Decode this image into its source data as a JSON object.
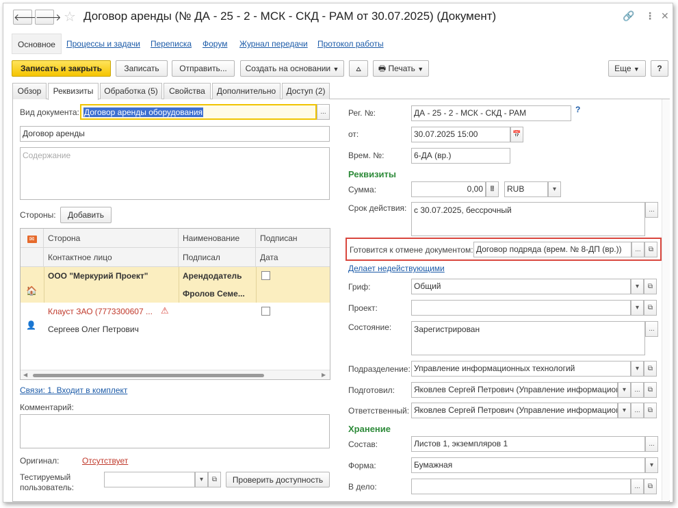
{
  "window": {
    "title": "Договор аренды (№ ДА - 25 - 2 - МСК - СКД - РАМ от 30.07.2025) (Документ)",
    "icons": {
      "back": "arrow-left-icon",
      "forward": "arrow-right-icon",
      "favorite": "star-icon",
      "link": "link-icon",
      "more": "more-vertical-icon",
      "close": "close-icon"
    }
  },
  "sections": [
    "Основное",
    "Процессы и задачи",
    "Переписка",
    "Форум",
    "Журнал передачи",
    "Протокол работы"
  ],
  "toolbar": {
    "save_close": "Записать и закрыть",
    "save": "Записать",
    "send": "Отправить...",
    "create_based": "Создать на основании",
    "share_icon": "share-icon",
    "print": "Печать",
    "more": "Еще",
    "help": "?"
  },
  "tabs": [
    "Обзор",
    "Реквизиты",
    "Обработка (5)",
    "Свойства",
    "Дополнительно",
    "Доступ (2)"
  ],
  "left": {
    "doc_type_label": "Вид документа:",
    "doc_type_value": "Договор аренды оборудования",
    "title_value": "Договор аренды",
    "content_placeholder": "Содержание",
    "parties_label": "Стороны:",
    "add_button": "Добавить",
    "grid": {
      "headers_row1": [
        "Сторона",
        "Наименование",
        "Подписан"
      ],
      "headers_row2": [
        "Контактное лицо",
        "Подписал",
        "Дата"
      ],
      "rows": [
        {
          "party": "ООО \"Меркурий Проект\"",
          "role": "Арендодатель",
          "signed": false
        },
        {
          "contact": "",
          "signer": "Фролов Семе..."
        },
        {
          "party": "Клауст ЗАО (7773300607 ...",
          "role": "",
          "signed": false,
          "warning": true
        },
        {
          "contact": "Сергеев Олег Петрович"
        }
      ]
    },
    "links_text": "Связи: 1. Входит в комплект",
    "comment_label": "Комментарий:",
    "original_label": "Оригинал:",
    "original_value": "Отсутствует",
    "test_user_label_1": "Тестируемый",
    "test_user_label_2": "пользователь:",
    "check_access_button": "Проверить доступность"
  },
  "right": {
    "reg_no_label": "Рег. №:",
    "reg_no_value": "ДА - 25 - 2 - МСК - СКД - РАМ",
    "help_mark": "?",
    "date_label": "от:",
    "date_value": "30.07.2025 15:00",
    "temp_no_label": "Врем. №:",
    "temp_no_value": "6-ДА (вр.)",
    "requisites_section": "Реквизиты",
    "sum_label": "Сумма:",
    "sum_value": "0,00",
    "currency_value": "RUB",
    "validity_label": "Срок действия:",
    "validity_value": "с 30.07.2025, бессрочный",
    "cancel_label": "Готовится к отмене документом:",
    "cancel_value": "Договор подряда (врем. № 8-ДП (вр.))",
    "invalidates_link": "Делает недействующими",
    "grif_label": "Гриф:",
    "grif_value": "Общий",
    "project_label": "Проект:",
    "project_value": "",
    "state_label": "Состояние:",
    "state_value": "Зарегистрирован",
    "department_label": "Подразделение:",
    "department_value": "Управление информационных технологий",
    "prepared_label": "Подготовил:",
    "prepared_value": "Яковлев Сергей Петрович (Управление информационны",
    "responsible_label": "Ответственный:",
    "responsible_value": "Яковлев Сергей Петрович (Управление информационны",
    "storage_section": "Хранение",
    "composition_label": "Состав:",
    "composition_value": "Листов 1, экземпляров 1",
    "form_label": "Форма:",
    "form_value": "Бумажная",
    "file_label": "В дело:",
    "file_value": ""
  },
  "colors": {
    "accent_yellow": "#f5c400",
    "link_blue": "#1c5ba8",
    "section_green": "#2e8b3a",
    "highlight_red": "#d9463d",
    "row_highlight": "#fbeec0"
  }
}
